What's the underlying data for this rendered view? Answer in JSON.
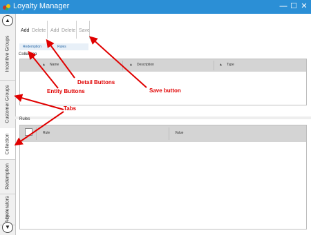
{
  "window": {
    "title": "Loyalty Manager",
    "controls": {
      "minimize": "—",
      "maximize": "☐",
      "close": "✕"
    }
  },
  "side_tabs": [
    "Incentive Groups",
    "Customer Groups",
    "Collection",
    "Redemption",
    "Accelerators",
    "ity"
  ],
  "side_nav": {
    "up": "▲",
    "down": "▼"
  },
  "toolbar": {
    "entity": {
      "add": "Add",
      "delete": "Delete"
    },
    "detail": {
      "add": "Add",
      "delete": "Delete"
    },
    "save": "Save"
  },
  "detail_tabs": [
    "Redemption",
    "Rules"
  ],
  "collection": {
    "label": "Collection",
    "columns": [
      "Name",
      "Description",
      "Type"
    ]
  },
  "rules": {
    "label": "Rules",
    "columns": [
      "Rule",
      "Value"
    ]
  },
  "annotations": {
    "detail_buttons": "Detail Buttons",
    "entity_buttons": "Entity Buttons",
    "save_button": "Save button",
    "tabs": "Tabs"
  },
  "colors": {
    "titlebar": "#2b8fd6",
    "annotation": "#e00000"
  }
}
